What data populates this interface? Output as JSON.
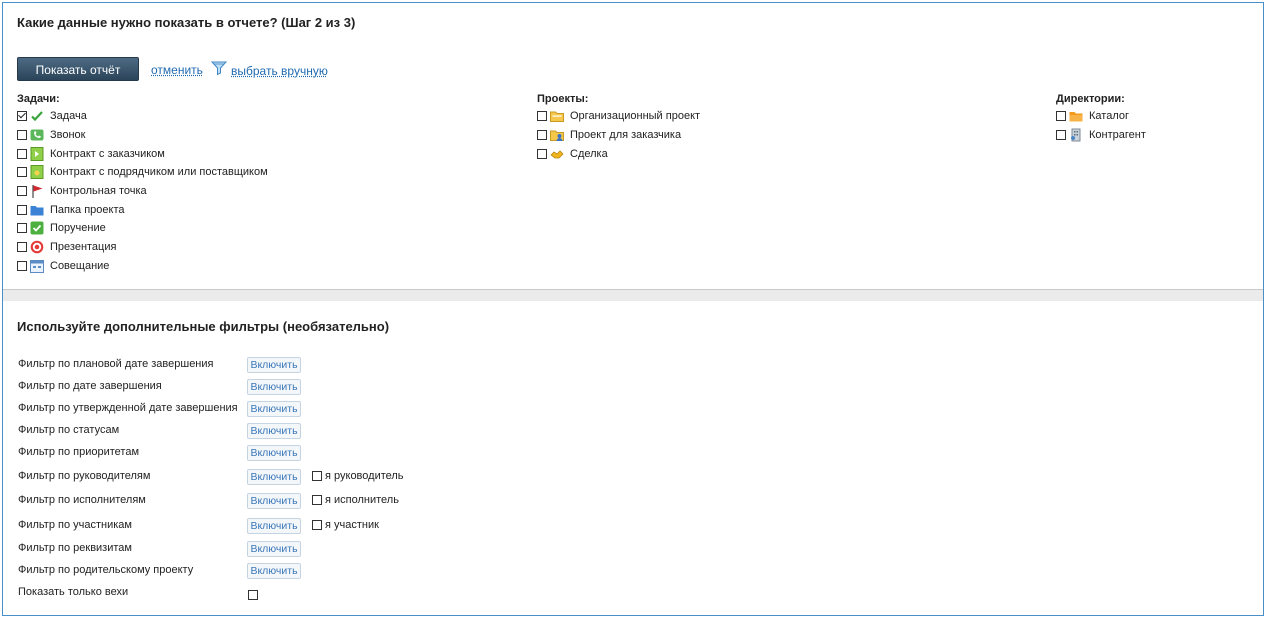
{
  "header": {
    "title": "Какие данные нужно показать в отчете? (Шаг 2 из 3)"
  },
  "toolbar": {
    "show_report": "Показать отчёт",
    "cancel": "отменить",
    "select_manually": "выбрать вручную"
  },
  "columns": {
    "tasks": {
      "title": "Задачи:",
      "items": [
        {
          "label": "Задача",
          "checked": true,
          "icon": "task-check-icon"
        },
        {
          "label": "Звонок",
          "checked": false,
          "icon": "phone-call-icon"
        },
        {
          "label": "Контракт с заказчиком",
          "checked": false,
          "icon": "contract-client-icon"
        },
        {
          "label": "Контракт с подрядчиком или поставщиком",
          "checked": false,
          "icon": "contract-supplier-icon"
        },
        {
          "label": "Контрольная точка",
          "checked": false,
          "icon": "flag-icon"
        },
        {
          "label": "Папка проекта",
          "checked": false,
          "icon": "folder-icon"
        },
        {
          "label": "Поручение",
          "checked": false,
          "icon": "assignment-check-icon"
        },
        {
          "label": "Презентация",
          "checked": false,
          "icon": "target-icon"
        },
        {
          "label": "Совещание",
          "checked": false,
          "icon": "meeting-calendar-icon"
        }
      ]
    },
    "projects": {
      "title": "Проекты:",
      "items": [
        {
          "label": "Организационный проект",
          "checked": false,
          "icon": "org-project-icon"
        },
        {
          "label": "Проект для заказчика",
          "checked": false,
          "icon": "client-project-icon"
        },
        {
          "label": "Сделка",
          "checked": false,
          "icon": "deal-icon"
        }
      ]
    },
    "directories": {
      "title": "Директории:",
      "items": [
        {
          "label": "Каталог",
          "checked": false,
          "icon": "catalog-folder-icon"
        },
        {
          "label": "Контрагент",
          "checked": false,
          "icon": "counterparty-icon"
        }
      ]
    }
  },
  "filters": {
    "title": "Используйте дополнительные фильтры (необязательно)",
    "enable_label": "Включить",
    "rows": [
      {
        "label": "Фильтр по плановой дате завершения"
      },
      {
        "label": "Фильтр по дате завершения"
      },
      {
        "label": "Фильтр по утвержденной дате завершения"
      },
      {
        "label": "Фильтр по статусам"
      },
      {
        "label": "Фильтр по приоритетам"
      },
      {
        "label": "Фильтр по руководителям",
        "me": "я руководитель"
      },
      {
        "label": "Фильтр по исполнителям",
        "me": "я исполнитель"
      },
      {
        "label": "Фильтр по участникам",
        "me": "я участник"
      },
      {
        "label": "Фильтр по реквизитам"
      },
      {
        "label": "Фильтр по родительскому проекту"
      }
    ],
    "milestones_label": "Показать только вехи"
  },
  "colors": {
    "frame": "#4a90c8",
    "link": "#1f6ab0",
    "button": "#2b4459"
  }
}
